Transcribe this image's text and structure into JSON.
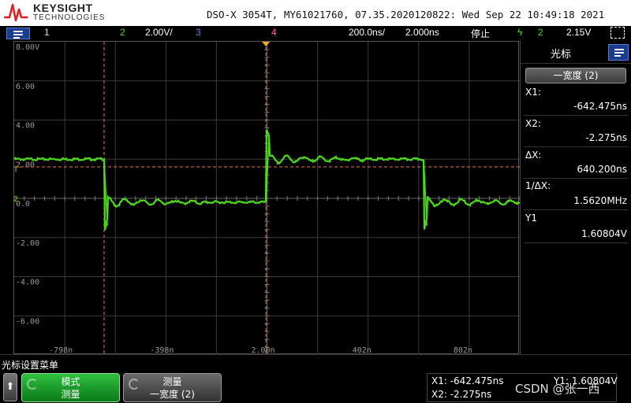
{
  "brand": {
    "name": "KEYSIGHT",
    "sub": "TECHNOLOGIES",
    "model_line": "DSO-X 3054T, MY61021760, 07.35.2020120822: Wed Sep 22 10:49:18 2021"
  },
  "status": {
    "ch1": "1",
    "ch2": "2",
    "ch2_scale": "2.00V/",
    "ch3": "3",
    "ch4": "4",
    "timebase": "200.0ns/",
    "delay": "2.000ns",
    "run_state": "停止",
    "trigger_source": "2",
    "trigger_level": "2.15V"
  },
  "graticule": {
    "y_labels": [
      "8.00V",
      "6.00",
      "4.00",
      "2.00",
      "0.0",
      "-2.00",
      "-4.00",
      "-6.00"
    ],
    "x_labels": [
      "-798n",
      "-398n",
      "2.00n",
      "402n",
      "802n"
    ],
    "trigger_marker": "T",
    "channel_marker": "2"
  },
  "waveform": {
    "color": "#4cd81b",
    "cursor_color": "#e07a50",
    "x1_ns": -642.475,
    "x2_ns": -2.275,
    "y1_v": 1.60804,
    "high_v": 2.0,
    "low_v": -0.2,
    "x_range_ns": [
      -998,
      1002
    ],
    "y_range_v": [
      -8,
      8
    ],
    "edges_ns": [
      {
        "t": -642,
        "dir": "fall"
      },
      {
        "t": -2,
        "dir": "rise"
      },
      {
        "t": 622,
        "dir": "fall"
      }
    ]
  },
  "panel": {
    "title": "光标",
    "mode_select": "一宽度 (2)",
    "x1_label": "X1:",
    "x1_value": "-642.475ns",
    "x2_label": "X2:",
    "x2_value": "-2.275ns",
    "dx_label": "ΔX:",
    "dx_value": "640.200ns",
    "inv_dx_label": "1/ΔX:",
    "inv_dx_value": "1.5620MHz",
    "y1_label": "Y1",
    "y1_value": "1.60804V"
  },
  "softkeys": {
    "menu_title": "光标设置菜单",
    "back": "⬆",
    "mode_top": "模式",
    "mode_bottom": "测量",
    "meas_top": "测量",
    "meas_bottom": "一宽度 (2)"
  },
  "readout": {
    "x1": "X1: -642.475ns",
    "x2": "X2: -2.275ns",
    "y1": "Y1: 1.60804V"
  },
  "watermark": "CSDN @张一西"
}
